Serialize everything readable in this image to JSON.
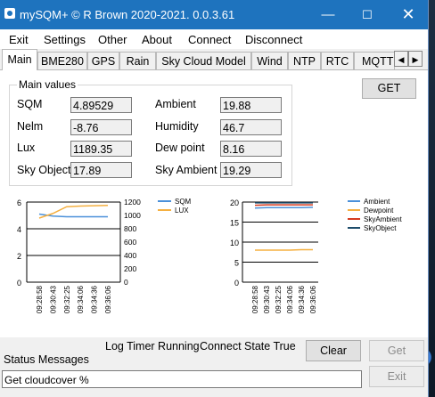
{
  "window": {
    "title": "mySQM+ © R Brown 2020-2021. 0.0.3.61"
  },
  "menu": [
    "Exit",
    "Settings",
    "Other",
    "About",
    "Connect",
    "Disconnect"
  ],
  "tabs": [
    "Main",
    "BME280",
    "GPS",
    "Rain",
    "Sky Cloud Model",
    "Wind",
    "NTP",
    "RTC",
    "MQTT"
  ],
  "main_values": {
    "group_label": "Main values",
    "sqm_label": "SQM",
    "sqm_value": "4.89529",
    "nelm_label": "Nelm",
    "nelm_value": "-8.76",
    "lux_label": "Lux",
    "lux_value": "1189.35",
    "skyobject_label": "Sky Object",
    "skyobject_value": "17.89",
    "ambient_label": "Ambient",
    "ambient_value": "19.88",
    "humidity_label": "Humidity",
    "humidity_value": "46.7",
    "dewpoint_label": "Dew point",
    "dewpoint_value": "8.16",
    "skyambient_label": "Sky Ambient",
    "skyambient_value": "19.29"
  },
  "buttons": {
    "get_main": "GET",
    "clear": "Clear",
    "get": "Get",
    "exit": "Exit"
  },
  "status": {
    "log_timer": "Log Timer  Running",
    "connect_state": "Connect State  True",
    "messages_label": "Status Messages",
    "message": "Get cloudcover %"
  },
  "colors": {
    "titlebar": "#1e73be",
    "sqm": "#4a90d9",
    "lux": "#f5b041",
    "ambient": "#4a90d9",
    "dewpoint": "#f5b041",
    "skyambient": "#d63b1f",
    "skyobject": "#1e4d6b"
  },
  "chart_data": [
    {
      "type": "line",
      "x": [
        "09:28:58",
        "09:30:43",
        "09:32:25",
        "09:34:06",
        "09:34:36",
        "09:36:06"
      ],
      "series": [
        {
          "name": "SQM",
          "axis": "left",
          "values": [
            5.1,
            4.95,
            4.9,
            4.9,
            4.9,
            4.9
          ]
        },
        {
          "name": "LUX",
          "axis": "right",
          "values": [
            960,
            1030,
            1130,
            1140,
            1145,
            1150
          ]
        }
      ],
      "ylim_left": [
        0,
        6
      ],
      "yticks_left": [
        "0",
        "2",
        "4",
        "6"
      ],
      "ylim_right": [
        0,
        1200
      ],
      "yticks_right": [
        "0",
        "200",
        "400",
        "600",
        "800",
        "1000",
        "1200"
      ],
      "legend": "top-right"
    },
    {
      "type": "line",
      "x": [
        "09:28:58",
        "09:30:43",
        "09:32:25",
        "09:34:06",
        "09:34:36",
        "09:36:06"
      ],
      "series": [
        {
          "name": "Ambient",
          "values": [
            18.5,
            18.6,
            18.6,
            18.6,
            18.6,
            18.7
          ]
        },
        {
          "name": "Dewpoint",
          "values": [
            8.0,
            8.0,
            8.0,
            8.0,
            8.1,
            8.1
          ]
        },
        {
          "name": "SkyAmbient",
          "values": [
            19.2,
            19.3,
            19.3,
            19.3,
            19.3,
            19.3
          ]
        },
        {
          "name": "SkyObject",
          "values": [
            19.8,
            19.8,
            19.8,
            19.8,
            19.8,
            19.8
          ]
        }
      ],
      "ylim": [
        0,
        20
      ],
      "yticks": [
        "0",
        "5",
        "10",
        "15",
        "20"
      ],
      "legend": "top-right"
    }
  ]
}
